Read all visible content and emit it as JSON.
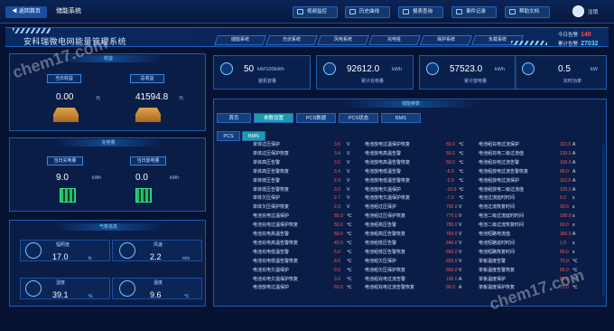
{
  "header": {
    "back_label": "返回首页",
    "app_title": "储能系统",
    "nav": [
      {
        "label": "视频监控",
        "icon": "video-icon"
      },
      {
        "label": "历史曲线",
        "icon": "chart-icon"
      },
      {
        "label": "报表查询",
        "icon": "search-icon"
      },
      {
        "label": "事件记录",
        "icon": "document-icon"
      },
      {
        "label": "帮助文档",
        "icon": "help-icon"
      }
    ],
    "logout_label": "注销"
  },
  "system_title": "安科瑞微电网能量管理系统",
  "system_tabs": [
    "储能系统",
    "光伏系统",
    "风电系统",
    "充电桩",
    "保护系统",
    "负载系统"
  ],
  "alarms": {
    "today_label": "今日告警:",
    "today_value": "140",
    "total_label": "累计告警:",
    "total_value": "27032"
  },
  "panels": {
    "income": {
      "title": "收益",
      "items": [
        {
          "label": "当日收益",
          "value": "0.00",
          "unit": "元"
        },
        {
          "label": "总收益",
          "value": "41594.8",
          "unit": "元"
        }
      ]
    },
    "charge": {
      "title": "充电量",
      "items": [
        {
          "label": "当日充电量",
          "value": "9.0",
          "unit": "kWh"
        },
        {
          "label": "当日放电量",
          "value": "0.0",
          "unit": "kWh"
        }
      ]
    },
    "weather": {
      "title": "气象信息",
      "items": [
        {
          "label": "辐照度",
          "value": "17.0",
          "unit": "lx",
          "icon": "sun-icon"
        },
        {
          "label": "风速",
          "value": "2.2",
          "unit": "m/s",
          "icon": "fan-icon"
        },
        {
          "label": "湿度",
          "value": "39.1",
          "unit": "%",
          "icon": "humidity-icon"
        },
        {
          "label": "温度",
          "value": "9.6",
          "unit": "℃",
          "icon": "thermometer-icon"
        }
      ]
    }
  },
  "cards": [
    {
      "value": "50",
      "unit": "kW/100kWh",
      "label": "装机容量",
      "icon": "battery-icon"
    },
    {
      "value": "92612.0",
      "unit": "kWh",
      "label": "累计充电量",
      "icon": "charge-icon"
    },
    {
      "value": "57523.0",
      "unit": "kWh",
      "label": "累计放电量",
      "icon": "discharge-icon"
    },
    {
      "value": "0.5",
      "unit": "kW",
      "label": "实时功率",
      "icon": "power-icon"
    }
  ],
  "main": {
    "title": "储能参数",
    "tabs": [
      "首页",
      "参数设置",
      "PCS数据",
      "PCS状态",
      "BMS"
    ],
    "active_tab": "参数设置",
    "subtabs": [
      "PCS",
      "BMS"
    ],
    "active_subtab": "BMS",
    "columns": [
      [
        {
          "name": "单体过压保护",
          "value": "3.6",
          "unit": "V"
        },
        {
          "name": "单体过压保护恢复",
          "value": "3.4",
          "unit": "V"
        },
        {
          "name": "单体高压告警",
          "value": "3.5",
          "unit": "V"
        },
        {
          "name": "单体高压告警恢复",
          "value": "3.4",
          "unit": "V"
        },
        {
          "name": "单体低压告警",
          "value": "2.9",
          "unit": "V"
        },
        {
          "name": "单体低压告警恢复",
          "value": "3.0",
          "unit": "V"
        },
        {
          "name": "单体欠压保护",
          "value": "2.7",
          "unit": "V"
        },
        {
          "name": "单体欠压保护恢复",
          "value": "2.9",
          "unit": "V"
        },
        {
          "name": "电池充电过温保护",
          "value": "55.0",
          "unit": "℃"
        },
        {
          "name": "电池充电过温保护恢复",
          "value": "50.0",
          "unit": "℃"
        },
        {
          "name": "电池充电高温告警",
          "value": "50.0",
          "unit": "℃"
        },
        {
          "name": "电池充电高温告警恢复",
          "value": "45.0",
          "unit": "℃"
        },
        {
          "name": "电池充电低温告警",
          "value": "5.0",
          "unit": "℃"
        },
        {
          "name": "电池充电低温告警恢复",
          "value": "8.0",
          "unit": "℃"
        },
        {
          "name": "电池充电欠温保护",
          "value": "0.0",
          "unit": "℃"
        },
        {
          "name": "电池充电欠温保护恢复",
          "value": "3.0",
          "unit": "℃"
        },
        {
          "name": "电池放电过温保护",
          "value": "60.0",
          "unit": "℃"
        }
      ],
      [
        {
          "name": "电池放电过温保护恢复",
          "value": "55.0",
          "unit": "℃"
        },
        {
          "name": "电池放电高温告警",
          "value": "55.0",
          "unit": "℃"
        },
        {
          "name": "电池放电高温告警恢复",
          "value": "50.0",
          "unit": "℃"
        },
        {
          "name": "电池放电低温告警",
          "value": "-5.0",
          "unit": "℃"
        },
        {
          "name": "电池放电低温告警恢复",
          "value": "-2.0",
          "unit": "℃"
        },
        {
          "name": "电池放电欠温保护",
          "value": "-10.0",
          "unit": "℃"
        },
        {
          "name": "电池放电欠温保护恢复",
          "value": "-7.0",
          "unit": "℃"
        },
        {
          "name": "电池组过压保护",
          "value": "792.0",
          "unit": "V"
        },
        {
          "name": "电池组过压保护恢复",
          "value": "770.0",
          "unit": "V"
        },
        {
          "name": "电池组高压告警",
          "value": "780.0",
          "unit": "V"
        },
        {
          "name": "电池组高压告警恢复",
          "value": "760.0",
          "unit": "V"
        },
        {
          "name": "电池组低压告警",
          "value": "640.0",
          "unit": "V"
        },
        {
          "name": "电池组低压告警恢复",
          "value": "660.0",
          "unit": "V"
        },
        {
          "name": "电池组欠压保护",
          "value": "620.0",
          "unit": "V"
        },
        {
          "name": "电池组欠压保护恢复",
          "value": "650.0",
          "unit": "V"
        },
        {
          "name": "电池组充电过流告警",
          "value": "100.0",
          "unit": "A"
        },
        {
          "name": "电池组充电过流告警恢复",
          "value": "90.0",
          "unit": "A"
        }
      ],
      [
        {
          "name": "电池组充电过流保护",
          "value": "110.0",
          "unit": "A"
        },
        {
          "name": "电池组充电二级过流值",
          "value": "120.0",
          "unit": "A"
        },
        {
          "name": "电池组充电过流告警",
          "value": "100.0",
          "unit": "A"
        },
        {
          "name": "电池组放电过流告警恢复",
          "value": "90.0",
          "unit": "A"
        },
        {
          "name": "电池组放电过流保护",
          "value": "110.0",
          "unit": "A"
        },
        {
          "name": "电池组放电二级过流值",
          "value": "120.0",
          "unit": "A"
        },
        {
          "name": "电池过流延时时间",
          "value": "5.0",
          "unit": "s"
        },
        {
          "name": "电池过流恢复时间",
          "value": "30.0",
          "unit": "s"
        },
        {
          "name": "电池二级过流延时时间",
          "value": "100.0",
          "unit": "s"
        },
        {
          "name": "电池二级过流恢复时间",
          "value": "60.0",
          "unit": "s"
        },
        {
          "name": "电池短路电流值",
          "value": "300.0",
          "unit": "A"
        },
        {
          "name": "电池短路延时时间",
          "value": "1.0",
          "unit": "s"
        },
        {
          "name": "电池短路恢复时间",
          "value": "60.0",
          "unit": "s"
        },
        {
          "name": "单板温度告警",
          "value": "70.0",
          "unit": "℃"
        },
        {
          "name": "单板温度告警恢复",
          "value": "65.0",
          "unit": "℃"
        },
        {
          "name": "单板温度保护",
          "value": "80.0",
          "unit": "℃"
        },
        {
          "name": "单板温度保护恢复",
          "value": "75.0",
          "unit": "℃"
        }
      ]
    ]
  },
  "watermarks": [
    "chem17.com",
    "chem17.com"
  ]
}
